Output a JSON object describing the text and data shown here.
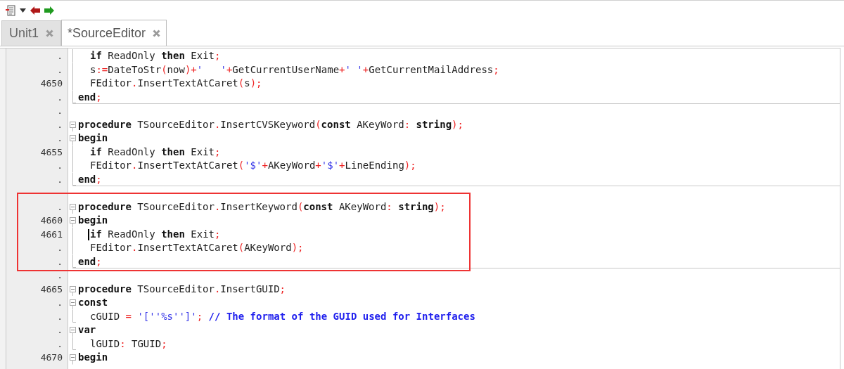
{
  "tabs": [
    {
      "label": "Unit1",
      "selected": false
    },
    {
      "label": "*SourceEditor",
      "selected": true
    }
  ],
  "editor": {
    "lines": [
      {
        "number": ".",
        "kind": "body",
        "indent": true,
        "tokens": [
          {
            "kind": "keyword",
            "text": "if"
          },
          {
            "kind": "plain",
            "text": " ReadOnly "
          },
          {
            "kind": "keyword",
            "text": "then"
          },
          {
            "kind": "plain",
            "text": " Exit"
          },
          {
            "kind": "symbol",
            "text": ";"
          }
        ]
      },
      {
        "number": ".",
        "kind": "body",
        "indent": true,
        "tokens": [
          {
            "kind": "plain",
            "text": "s"
          },
          {
            "kind": "symbol",
            "text": ":="
          },
          {
            "kind": "plain",
            "text": "DateToStr"
          },
          {
            "kind": "symbol",
            "text": "("
          },
          {
            "kind": "plain",
            "text": "now"
          },
          {
            "kind": "symbol",
            "text": ")+"
          },
          {
            "kind": "string",
            "text": "'   '"
          },
          {
            "kind": "symbol",
            "text": "+"
          },
          {
            "kind": "plain",
            "text": "GetCurrentUserName"
          },
          {
            "kind": "symbol",
            "text": "+"
          },
          {
            "kind": "string",
            "text": "' '"
          },
          {
            "kind": "symbol",
            "text": "+"
          },
          {
            "kind": "plain",
            "text": "GetCurrentMailAddress"
          },
          {
            "kind": "symbol",
            "text": ";"
          }
        ]
      },
      {
        "number": "4650",
        "kind": "body",
        "indent": true,
        "tokens": [
          {
            "kind": "plain",
            "text": "FEditor"
          },
          {
            "kind": "symbol",
            "text": "."
          },
          {
            "kind": "plain",
            "text": "InsertTextAtCaret"
          },
          {
            "kind": "symbol",
            "text": "("
          },
          {
            "kind": "plain",
            "text": "s"
          },
          {
            "kind": "symbol",
            "text": ");"
          }
        ]
      },
      {
        "number": ".",
        "kind": "end",
        "separator_below": true,
        "tokens": [
          {
            "kind": "keyword",
            "text": "end"
          },
          {
            "kind": "symbol",
            "text": ";"
          }
        ]
      },
      {
        "number": ".",
        "kind": "blank"
      },
      {
        "number": ".",
        "kind": "start",
        "tokens": [
          {
            "kind": "keyword",
            "text": "procedure"
          },
          {
            "kind": "plain",
            "text": " TSourceEditor"
          },
          {
            "kind": "symbol",
            "text": "."
          },
          {
            "kind": "plain",
            "text": "InsertCVSKeyword"
          },
          {
            "kind": "symbol",
            "text": "("
          },
          {
            "kind": "keyword",
            "text": "const"
          },
          {
            "kind": "plain",
            "text": " AKeyWord"
          },
          {
            "kind": "symbol",
            "text": ": "
          },
          {
            "kind": "keyword",
            "text": "string"
          },
          {
            "kind": "symbol",
            "text": ");"
          }
        ]
      },
      {
        "number": ".",
        "kind": "start",
        "tokens": [
          {
            "kind": "keyword",
            "text": "begin"
          }
        ]
      },
      {
        "number": "4655",
        "kind": "body",
        "indent": true,
        "tokens": [
          {
            "kind": "keyword",
            "text": "if"
          },
          {
            "kind": "plain",
            "text": " ReadOnly "
          },
          {
            "kind": "keyword",
            "text": "then"
          },
          {
            "kind": "plain",
            "text": " Exit"
          },
          {
            "kind": "symbol",
            "text": ";"
          }
        ]
      },
      {
        "number": ".",
        "kind": "body",
        "indent": true,
        "tokens": [
          {
            "kind": "plain",
            "text": "FEditor"
          },
          {
            "kind": "symbol",
            "text": "."
          },
          {
            "kind": "plain",
            "text": "InsertTextAtCaret"
          },
          {
            "kind": "symbol",
            "text": "("
          },
          {
            "kind": "string",
            "text": "'$'"
          },
          {
            "kind": "symbol",
            "text": "+"
          },
          {
            "kind": "plain",
            "text": "AKeyWord"
          },
          {
            "kind": "symbol",
            "text": "+"
          },
          {
            "kind": "string",
            "text": "'$'"
          },
          {
            "kind": "symbol",
            "text": "+"
          },
          {
            "kind": "plain",
            "text": "LineEnding"
          },
          {
            "kind": "symbol",
            "text": ");"
          }
        ]
      },
      {
        "number": ".",
        "kind": "end",
        "separator_below": true,
        "tokens": [
          {
            "kind": "keyword",
            "text": "end"
          },
          {
            "kind": "symbol",
            "text": ";"
          }
        ]
      },
      {
        "kind": "blank"
      },
      {
        "number": ".",
        "kind": "start",
        "highlighted": true,
        "tokens": [
          {
            "kind": "keyword",
            "text": "procedure"
          },
          {
            "kind": "plain",
            "text": " TSourceEditor"
          },
          {
            "kind": "symbol",
            "text": "."
          },
          {
            "kind": "plain",
            "text": "InsertKeyword"
          },
          {
            "kind": "symbol",
            "text": "("
          },
          {
            "kind": "keyword",
            "text": "const"
          },
          {
            "kind": "plain",
            "text": " AKeyWord"
          },
          {
            "kind": "symbol",
            "text": ": "
          },
          {
            "kind": "keyword",
            "text": "string"
          },
          {
            "kind": "symbol",
            "text": ");"
          }
        ]
      },
      {
        "number": "4660",
        "kind": "start",
        "highlighted": true,
        "tokens": [
          {
            "kind": "keyword",
            "text": "begin"
          }
        ]
      },
      {
        "number": "4661",
        "kind": "body",
        "indent": true,
        "highlighted": true,
        "caret": true,
        "tokens": [
          {
            "kind": "keyword",
            "text": "if"
          },
          {
            "kind": "plain",
            "text": " ReadOnly "
          },
          {
            "kind": "keyword",
            "text": "then"
          },
          {
            "kind": "plain",
            "text": " Exit"
          },
          {
            "kind": "symbol",
            "text": ";"
          }
        ]
      },
      {
        "number": ".",
        "kind": "body",
        "indent": true,
        "highlighted": true,
        "tokens": [
          {
            "kind": "plain",
            "text": "FEditor"
          },
          {
            "kind": "symbol",
            "text": "."
          },
          {
            "kind": "plain",
            "text": "InsertTextAtCaret"
          },
          {
            "kind": "symbol",
            "text": "("
          },
          {
            "kind": "plain",
            "text": "AKeyWord"
          },
          {
            "kind": "symbol",
            "text": ");"
          }
        ]
      },
      {
        "number": ".",
        "kind": "end",
        "highlighted": true,
        "separator_below": true,
        "tokens": [
          {
            "kind": "keyword",
            "text": "end"
          },
          {
            "kind": "symbol",
            "text": ";"
          }
        ]
      },
      {
        "number": ".",
        "kind": "blank"
      },
      {
        "number": "4665",
        "kind": "start",
        "tokens": [
          {
            "kind": "keyword",
            "text": "procedure"
          },
          {
            "kind": "plain",
            "text": " TSourceEditor"
          },
          {
            "kind": "symbol",
            "text": "."
          },
          {
            "kind": "plain",
            "text": "InsertGUID"
          },
          {
            "kind": "symbol",
            "text": ";"
          }
        ]
      },
      {
        "number": ".",
        "kind": "start",
        "tokens": [
          {
            "kind": "keyword",
            "text": "const"
          }
        ]
      },
      {
        "number": ".",
        "kind": "end",
        "indent": true,
        "tokens": [
          {
            "kind": "plain",
            "text": "cGUID "
          },
          {
            "kind": "symbol",
            "text": "= "
          },
          {
            "kind": "string",
            "text": "'[''%s'']'"
          },
          {
            "kind": "symbol",
            "text": "; "
          },
          {
            "kind": "comment",
            "text": "// The format of the GUID used for Interfaces"
          }
        ]
      },
      {
        "number": ".",
        "kind": "start",
        "tokens": [
          {
            "kind": "keyword",
            "text": "var"
          }
        ]
      },
      {
        "number": ".",
        "kind": "end",
        "indent": true,
        "tokens": [
          {
            "kind": "plain",
            "text": "lGUID"
          },
          {
            "kind": "symbol",
            "text": ": "
          },
          {
            "kind": "plain",
            "text": "TGUID"
          },
          {
            "kind": "symbol",
            "text": ";"
          }
        ]
      },
      {
        "number": "4670",
        "kind": "start",
        "tokens": [
          {
            "kind": "keyword",
            "text": "begin"
          }
        ]
      }
    ]
  }
}
